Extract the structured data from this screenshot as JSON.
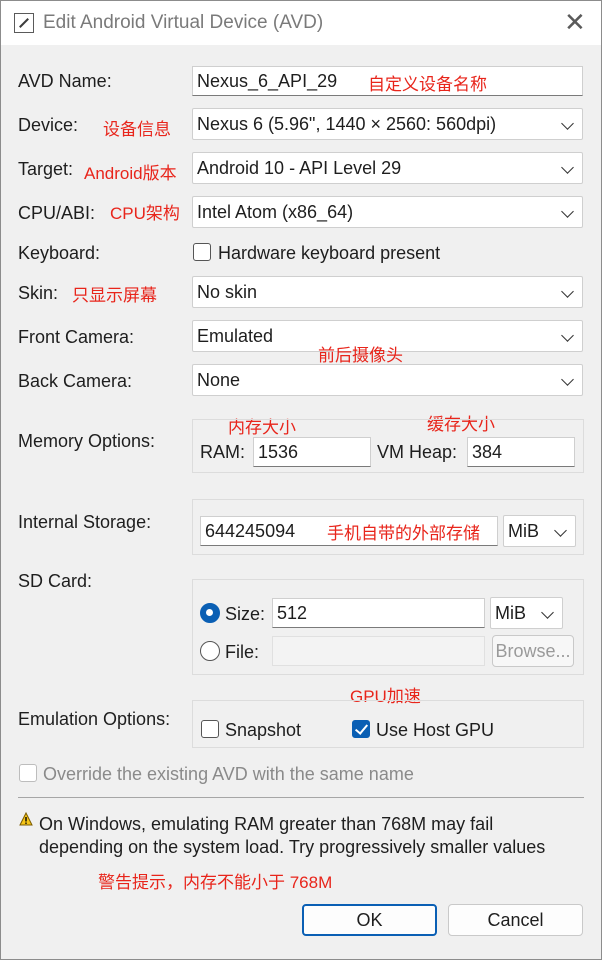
{
  "window": {
    "title": "Edit Android Virtual Device (AVD)",
    "close_glyph": "✕"
  },
  "form": {
    "avd_name": {
      "label": "AVD Name:",
      "value": "Nexus_6_API_29",
      "note": "自定义设备名称"
    },
    "device": {
      "label": "Device:",
      "value": "Nexus 6 (5.96\", 1440 × 2560: 560dpi)",
      "note": "设备信息"
    },
    "target": {
      "label": "Target:",
      "value": "Android 10 - API Level 29",
      "note": "Android版本"
    },
    "cpu_abi": {
      "label": "CPU/ABI:",
      "value": "Intel Atom (x86_64)",
      "note": "CPU架构"
    },
    "keyboard": {
      "label": "Keyboard:",
      "checkbox_label": "Hardware keyboard present",
      "checked": false
    },
    "skin": {
      "label": "Skin:",
      "value": "No skin",
      "note": "只显示屏幕"
    },
    "front_camera": {
      "label": "Front Camera:",
      "value": "Emulated",
      "note": "前后摄像头"
    },
    "back_camera": {
      "label": "Back Camera:",
      "value": "None"
    },
    "memory": {
      "label": "Memory Options:",
      "ram_label": "RAM:",
      "ram_value": "1536",
      "ram_note": "内存大小",
      "vm_heap_label": "VM Heap:",
      "vm_heap_value": "384",
      "vm_heap_note": "缓存大小"
    },
    "internal_storage": {
      "label": "Internal Storage:",
      "value": "644245094",
      "unit": "MiB",
      "note": "手机自带的外部存储"
    },
    "sd_card": {
      "label": "SD Card:",
      "size_label": "Size:",
      "size_value": "512",
      "size_unit": "MiB",
      "size_selected": true,
      "file_label": "File:",
      "file_value": "",
      "browse_label": "Browse..."
    },
    "emulation": {
      "label": "Emulation Options:",
      "note": "GPU加速",
      "snapshot_label": "Snapshot",
      "snapshot_checked": false,
      "host_gpu_label": "Use Host GPU",
      "host_gpu_checked": true
    },
    "override": {
      "label": "Override the existing AVD with the same name",
      "checked": false
    }
  },
  "warning": {
    "icon": "warning-icon",
    "line1": "On Windows, emulating RAM greater than 768M may fail",
    "line2": "depending on the system load. Try progressively smaller values",
    "note": "警告提示，内存不能小于 768M"
  },
  "buttons": {
    "ok": "OK",
    "cancel": "Cancel"
  },
  "colors": {
    "accent": "#0a5fb4",
    "annotation": "#e8251b",
    "background": "#f0f0f0"
  }
}
